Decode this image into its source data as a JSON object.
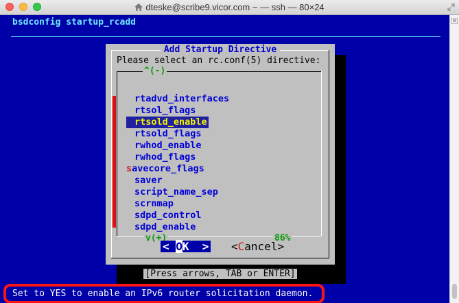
{
  "window": {
    "title": "dteske@scribe9.vicor.com ~ — ssh — 80×24"
  },
  "terminal": {
    "program": "bsdconfig startup_rcadd",
    "status_line": "Set to YES to enable an IPv6 router solicitation daemon."
  },
  "dialog": {
    "title": "Add Startup Directive",
    "prompt": "Please select an rc.conf(5) directive:",
    "scroll_up": "^(-)",
    "scroll_down": "v(+)",
    "percent": "86%",
    "items": [
      {
        "hot": "",
        "rest": "rtadvd_interfaces"
      },
      {
        "hot": "",
        "rest": "rtsol_flags"
      },
      {
        "hot": "",
        "rest": "rtsold_enable"
      },
      {
        "hot": "",
        "rest": "rtsold_flags"
      },
      {
        "hot": "",
        "rest": "rwhod_enable"
      },
      {
        "hot": "",
        "rest": "rwhod_flags"
      },
      {
        "hot": "s",
        "rest": "avecore_flags"
      },
      {
        "hot": "",
        "rest": "saver"
      },
      {
        "hot": "",
        "rest": "script_name_sep"
      },
      {
        "hot": "",
        "rest": "scrnmap"
      },
      {
        "hot": "",
        "rest": "sdpd_control"
      },
      {
        "hot": "",
        "rest": "sdpd_enable"
      }
    ],
    "selected_index": 2,
    "ok_button": {
      "left": "< ",
      "hot": "O",
      "right": "K  >"
    },
    "cancel_button": {
      "left": "<",
      "hot": "C",
      "right": "ancel>"
    },
    "hint": "[Press arrows, TAB or ENTER]"
  },
  "colors": {
    "terminal_bg": "#0000a8",
    "dialog_bg": "#c0c0c0",
    "highlight_ring": "#ff1414"
  }
}
